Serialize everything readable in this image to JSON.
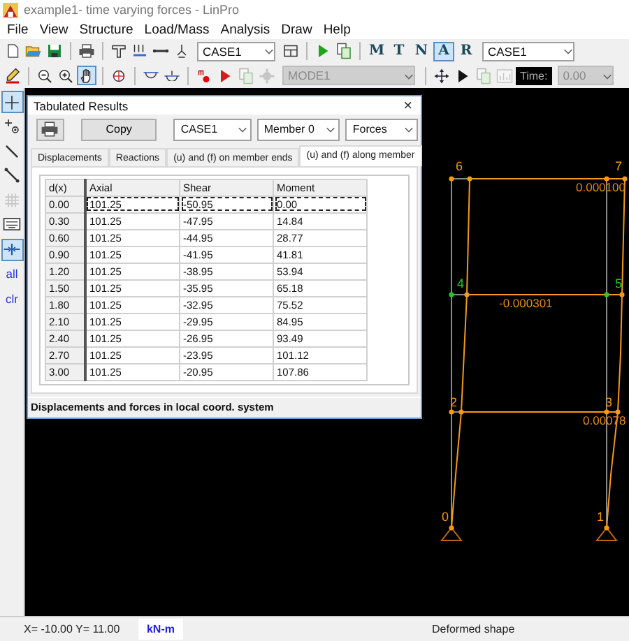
{
  "window": {
    "title": "example1- time varying forces - LinPro"
  },
  "menu": [
    "File",
    "View",
    "Structure",
    "Load/Mass",
    "Analysis",
    "Draw",
    "Help"
  ],
  "toolbar_1": [
    {
      "kind": "new",
      "pressed": false,
      "disabled": false
    },
    {
      "kind": "open",
      "pressed": false,
      "disabled": false
    },
    {
      "kind": "save",
      "pressed": false,
      "disabled": false
    },
    {
      "kind": "separator"
    },
    {
      "kind": "print",
      "pressed": false,
      "disabled": false
    },
    {
      "kind": "separator"
    },
    {
      "kind": "tbeam",
      "pressed": false,
      "disabled": false
    },
    {
      "kind": "load",
      "pressed": false,
      "disabled": false
    },
    {
      "kind": "member",
      "pressed": false,
      "disabled": false
    },
    {
      "kind": "support",
      "pressed": false,
      "disabled": false
    },
    {
      "kind": "combo",
      "value": "CASE1",
      "disabled": false
    },
    {
      "kind": "frame",
      "pressed": false,
      "disabled": false
    },
    {
      "kind": "separator"
    },
    {
      "kind": "play_green",
      "pressed": false,
      "disabled": false
    },
    {
      "kind": "copy",
      "pressed": false,
      "disabled": false
    },
    {
      "kind": "separator"
    },
    {
      "kind": "letter",
      "text": "M",
      "pressed": false,
      "disabled": false
    },
    {
      "kind": "letter",
      "text": "T",
      "pressed": false,
      "disabled": false
    },
    {
      "kind": "letter",
      "text": "N",
      "pressed": false,
      "disabled": false
    },
    {
      "kind": "letter",
      "text": "A",
      "pressed": true,
      "disabled": false
    },
    {
      "kind": "letter",
      "text": "R",
      "pressed": false,
      "disabled": false
    },
    {
      "kind": "combo",
      "value": "CASE1",
      "disabled": false
    }
  ],
  "toolbar_2": [
    {
      "kind": "pencil",
      "pressed": false,
      "disabled": false
    },
    {
      "kind": "separator"
    },
    {
      "kind": "zoom_out",
      "pressed": false,
      "disabled": false
    },
    {
      "kind": "zoom_in",
      "pressed": false,
      "disabled": false
    },
    {
      "kind": "hand",
      "pressed": true,
      "disabled": false
    },
    {
      "kind": "separator"
    },
    {
      "kind": "zoom_window",
      "pressed": false,
      "disabled": false
    },
    {
      "kind": "separator"
    },
    {
      "kind": "hinge",
      "pressed": false,
      "disabled": false
    },
    {
      "kind": "hinge_plus",
      "pressed": false,
      "disabled": false
    },
    {
      "kind": "separator"
    },
    {
      "kind": "marker",
      "pressed": false,
      "disabled": false
    },
    {
      "kind": "play_red",
      "pressed": false,
      "disabled": false
    },
    {
      "kind": "copy",
      "pressed": false,
      "disabled": true
    },
    {
      "kind": "gear",
      "pressed": false,
      "disabled": true
    },
    {
      "kind": "combo",
      "value": "MODE1",
      "disabled": true
    },
    {
      "kind": "separator"
    },
    {
      "kind": "move",
      "pressed": false,
      "disabled": false
    },
    {
      "kind": "play_black",
      "pressed": false,
      "disabled": false
    },
    {
      "kind": "copy",
      "pressed": false,
      "disabled": true
    },
    {
      "kind": "chart",
      "pressed": false,
      "disabled": true
    },
    {
      "kind": "label",
      "text": "Time:"
    },
    {
      "kind": "combo",
      "value": "0.00",
      "disabled": true
    }
  ],
  "side_toolbar": [
    {
      "kind": "plus",
      "pressed": true,
      "disabled": false
    },
    {
      "kind": "node_add",
      "pressed": false,
      "disabled": false
    },
    {
      "kind": "line",
      "pressed": false,
      "disabled": false
    },
    {
      "kind": "node_line",
      "pressed": false,
      "disabled": false
    },
    {
      "kind": "grid",
      "pressed": false,
      "disabled": true
    },
    {
      "kind": "table",
      "pressed": false,
      "disabled": false
    },
    {
      "kind": "snap",
      "pressed": true,
      "disabled": false
    },
    {
      "kind": "text",
      "text": "all",
      "pressed": false,
      "disabled": false
    },
    {
      "kind": "text",
      "text": "clr",
      "pressed": false,
      "disabled": false
    }
  ],
  "structure": {
    "nodes": [
      {
        "label": "6",
        "color": "#ff9900"
      },
      {
        "label": "7",
        "color": "#ff9900"
      },
      {
        "label": "4",
        "color": "#22cc22"
      },
      {
        "label": "5",
        "color": "#22cc22"
      },
      {
        "label": "2",
        "color": "#ff9900"
      },
      {
        "label": "3",
        "color": "#ff9900"
      },
      {
        "label": "0",
        "color": "#ff9900"
      },
      {
        "label": "1",
        "color": "#ff9900"
      }
    ],
    "values": [
      "0.000100",
      "-0.000301",
      "0.00078"
    ]
  },
  "dialog": {
    "title": "Tabulated Results",
    "close": "×",
    "copy_button": "Copy",
    "selectors": [
      "CASE1",
      "Member 0",
      "Forces"
    ],
    "tabs": [
      {
        "label": "Displacements",
        "selected": false
      },
      {
        "label": "Reactions",
        "selected": false
      },
      {
        "label": "(u) and (f) on member ends",
        "selected": false
      },
      {
        "label": "(u) and (f) along member",
        "selected": true
      }
    ],
    "table": {
      "columns": [
        "d(x)",
        "Axial",
        "Shear",
        "Moment"
      ],
      "rows": [
        {
          "cells": [
            "0.00",
            "101.25",
            "-50.95",
            "0.00"
          ],
          "focused": true
        },
        {
          "cells": [
            "0.30",
            "101.25",
            "-47.95",
            "14.84"
          ],
          "focused": false
        },
        {
          "cells": [
            "0.60",
            "101.25",
            "-44.95",
            "28.77"
          ],
          "focused": false
        },
        {
          "cells": [
            "0.90",
            "101.25",
            "-41.95",
            "41.81"
          ],
          "focused": false
        },
        {
          "cells": [
            "1.20",
            "101.25",
            "-38.95",
            "53.94"
          ],
          "focused": false
        },
        {
          "cells": [
            "1.50",
            "101.25",
            "-35.95",
            "65.18"
          ],
          "focused": false
        },
        {
          "cells": [
            "1.80",
            "101.25",
            "-32.95",
            "75.52"
          ],
          "focused": false
        },
        {
          "cells": [
            "2.10",
            "101.25",
            "-29.95",
            "84.95"
          ],
          "focused": false
        },
        {
          "cells": [
            "2.40",
            "101.25",
            "-26.95",
            "93.49"
          ],
          "focused": false
        },
        {
          "cells": [
            "2.70",
            "101.25",
            "-23.95",
            "101.12"
          ],
          "focused": false
        },
        {
          "cells": [
            "3.00",
            "101.25",
            "-20.95",
            "107.86"
          ],
          "focused": false
        }
      ]
    },
    "footer": "Displacements and forces in local coord. system"
  },
  "status_bar": {
    "coordinates": "X= -10.00 Y= 11.00",
    "units": "kN-m",
    "mode": "Deformed shape"
  }
}
